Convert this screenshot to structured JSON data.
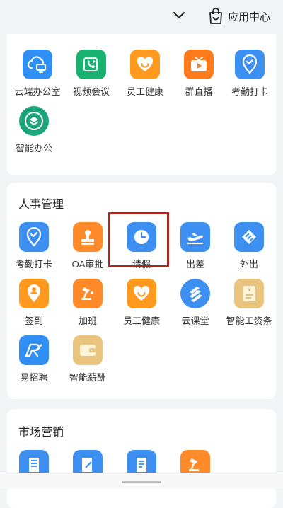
{
  "header": {
    "app_center_label": "应用中心"
  },
  "section1": {
    "apps": [
      {
        "label": "云端办公室",
        "icon": "cloud-desktop-icon",
        "color": "#2f8ff5"
      },
      {
        "label": "视频会议",
        "icon": "video-call-icon",
        "color": "#18b16f"
      },
      {
        "label": "员工健康",
        "icon": "heart-smile-icon",
        "color": "#ff9a1f"
      },
      {
        "label": "群直播",
        "icon": "tv-play-icon",
        "color": "#ff7a1a"
      },
      {
        "label": "考勤打卡",
        "icon": "location-check-icon",
        "color": "#3d8ff2"
      },
      {
        "label": "智能办公",
        "icon": "layers-icon",
        "color": "#1aa67a"
      }
    ]
  },
  "section2": {
    "title": "人事管理",
    "apps": [
      {
        "label": "考勤打卡",
        "icon": "location-check-icon",
        "color": "#3d8ff2"
      },
      {
        "label": "OA审批",
        "icon": "stamp-icon",
        "color": "#ff8a2a"
      },
      {
        "label": "请假",
        "icon": "clock-icon",
        "color": "#3d8ff2"
      },
      {
        "label": "出差",
        "icon": "airplane-icon",
        "color": "#3d8ff2"
      },
      {
        "label": "外出",
        "icon": "ticket-icon",
        "color": "#3d8ff2"
      },
      {
        "label": "签到",
        "icon": "location-user-icon",
        "color": "#ff9a1f"
      },
      {
        "label": "加班",
        "icon": "desk-lamp-icon",
        "color": "#ff8a2a"
      },
      {
        "label": "员工健康",
        "icon": "heart-smile-icon",
        "color": "#ff9a1f"
      },
      {
        "label": "云课堂",
        "icon": "stripes-icon",
        "color": "#3d8ff2"
      },
      {
        "label": "智能工资条",
        "icon": "salary-slip-icon",
        "color": "#e9c47e"
      },
      {
        "label": "易招聘",
        "icon": "recruit-logo-icon",
        "color": "#2f8ff5"
      },
      {
        "label": "智能薪酬",
        "icon": "wallet-icon",
        "color": "#e9c47e"
      }
    ]
  },
  "section3": {
    "title": "市场营销",
    "apps": [
      {
        "icon": "building-icon",
        "color": "#3d8ff2"
      },
      {
        "icon": "edit-doc-icon",
        "color": "#3d8ff2"
      },
      {
        "icon": "document-icon",
        "color": "#3d8ff2"
      },
      {
        "icon": "desk-lamp-icon",
        "color": "#ff8a2a"
      }
    ]
  }
}
